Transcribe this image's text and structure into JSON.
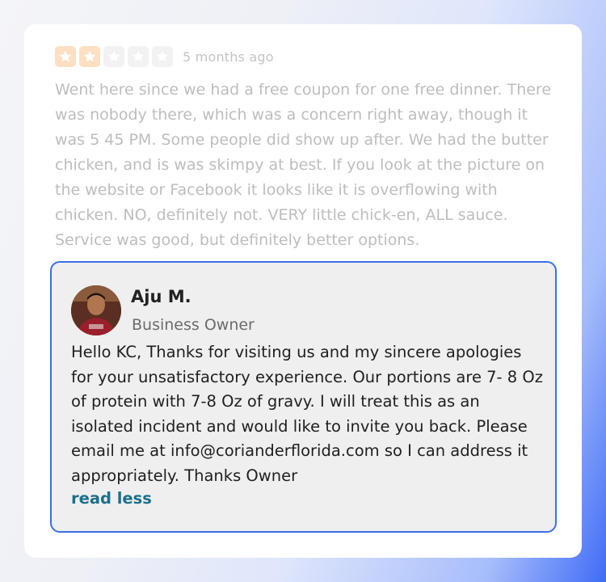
{
  "review": {
    "rating": 2,
    "max_rating": 5,
    "timestamp": "5 months ago",
    "text": "Went here since we had a free coupon for one free dinner. There was nobody there, which was a concern right away, though it was 5 45 PM. Some people did show up after. We had the butter chicken, and is was skimpy at best. If you look at the picture on the website or Facebook it looks like it is overflowing with chicken. NO, definitely not. VERY little chick-en, ALL sauce. Service was good, but definitely better options."
  },
  "reply": {
    "name": "Aju M.",
    "role": "Business Owner",
    "text": "Hello KC, Thanks for visiting us and my sincere apologies for your unsatisfactory experience. Our portions are 7- 8 Oz of protein with 7-8 Oz of gravy. I will treat this as an isolated incident and would like to invite you back. Please email me at info@corianderflorida.com so I can address it appropriately. Thanks Owner",
    "read_less_label": "read less"
  },
  "colors": {
    "star_filled": "#fde0c3",
    "star_empty": "#f2f2f2",
    "reply_border": "#3b6fe6",
    "link": "#1d6f8a"
  }
}
